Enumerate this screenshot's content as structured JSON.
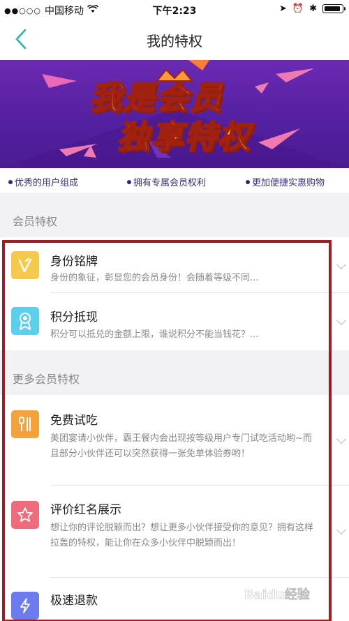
{
  "status_bar": {
    "carrier": "中国移动",
    "time": "下午2:23"
  },
  "nav": {
    "title": "我的特权"
  },
  "banner": {
    "line1": "我是会员",
    "line2": "独享特权"
  },
  "features": [
    "优秀的用户组成",
    "拥有专属会员权利",
    "更加便捷实惠购物"
  ],
  "section1": {
    "title": "会员特权",
    "items": [
      {
        "title": "身份铭牌",
        "desc": "身份的象征，彰显您的会员身份！会随着等级不同..."
      },
      {
        "title": "积分抵现",
        "desc": "积分可以抵兑的金额上限，谁说积分不能当钱花？..."
      }
    ]
  },
  "section2": {
    "title": "更多会员特权",
    "items": [
      {
        "title": "免费试吃",
        "desc": "美团宴请小伙伴，霸王餐内会出现按等级用户专门试吃活动哟~而且部分小伙伴还可以突然获得一张免单体验券哟！"
      },
      {
        "title": "评价红名展示",
        "desc": "想让你的评论脱颖而出？想让更多小伙伴接受你的意见？拥有这样拉轰的特权，能让你在众多小伙伴中脱颖而出！"
      },
      {
        "title": "极速退款",
        "desc": ""
      }
    ]
  },
  "colors": {
    "banner_purple": "#5a23a6",
    "highlight_red": "#9f1d20",
    "back_teal": "#2bb5a6",
    "icon_yellow": "#f6c84c",
    "icon_cyan": "#5ccfee",
    "icon_orange": "#f4a23c",
    "icon_pink": "#ef6b7b",
    "icon_blue": "#6c7cf0"
  },
  "watermark": "Baidu经验"
}
